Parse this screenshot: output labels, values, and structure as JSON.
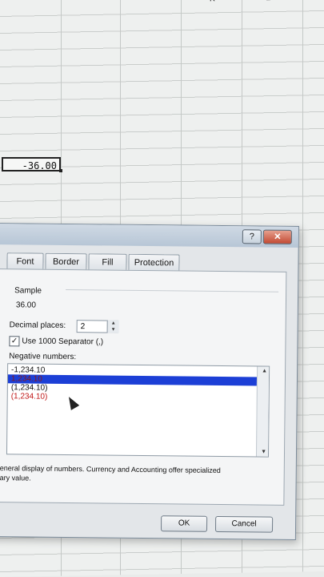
{
  "sheet": {
    "columns": [
      "K",
      "L"
    ],
    "active_cell_value": "-36.00"
  },
  "dialog": {
    "title_buttons": {
      "help": "?",
      "close": "✕"
    },
    "tabs": [
      "Font",
      "Border",
      "Fill",
      "Protection"
    ],
    "sample": {
      "label": "Sample",
      "value": "36.00"
    },
    "decimal_places": {
      "label": "Decimal places:",
      "value": "2"
    },
    "separator": {
      "label": "Use 1000 Separator (,)",
      "checked": true
    },
    "negative_numbers": {
      "label": "Negative numbers:",
      "items": [
        {
          "text": "-1,234.10",
          "color": "#111111"
        },
        {
          "text": "1,234.10",
          "color": "#b01010",
          "selected": true
        },
        {
          "text": "(1,234.10)",
          "color": "#111111"
        },
        {
          "text": "(1,234.10)",
          "color": "#c01818"
        }
      ]
    },
    "description_line1": "eneral display of numbers.  Currency and Accounting offer specialized",
    "description_line2": "ary value.",
    "ok_label": "OK",
    "cancel_label": "Cancel"
  }
}
